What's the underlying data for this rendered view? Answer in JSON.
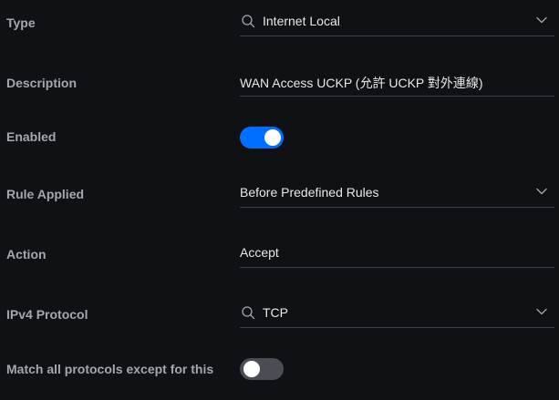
{
  "colors": {
    "background": "#101114",
    "label": "#a4a7ad",
    "value": "#e6e8eb",
    "toggle_on": "#006fff",
    "toggle_off": "#4a4d53"
  },
  "form": {
    "type": {
      "label": "Type",
      "value": "Internet Local",
      "icon": "search-icon",
      "control": "searchable-dropdown"
    },
    "description": {
      "label": "Description",
      "value": "WAN Access UCKP (允許 UCKP 對外連線)",
      "control": "text-input"
    },
    "enabled": {
      "label": "Enabled",
      "checked": true,
      "control": "toggle"
    },
    "rule_applied": {
      "label": "Rule Applied",
      "value": "Before Predefined Rules",
      "control": "dropdown"
    },
    "action": {
      "label": "Action",
      "value": "Accept",
      "control": "text-input"
    },
    "ipv4_protocol": {
      "label": "IPv4 Protocol",
      "value": "TCP",
      "icon": "search-icon",
      "control": "searchable-dropdown"
    },
    "match_all_except": {
      "label": "Match all protocols except for this",
      "checked": false,
      "control": "toggle"
    }
  }
}
